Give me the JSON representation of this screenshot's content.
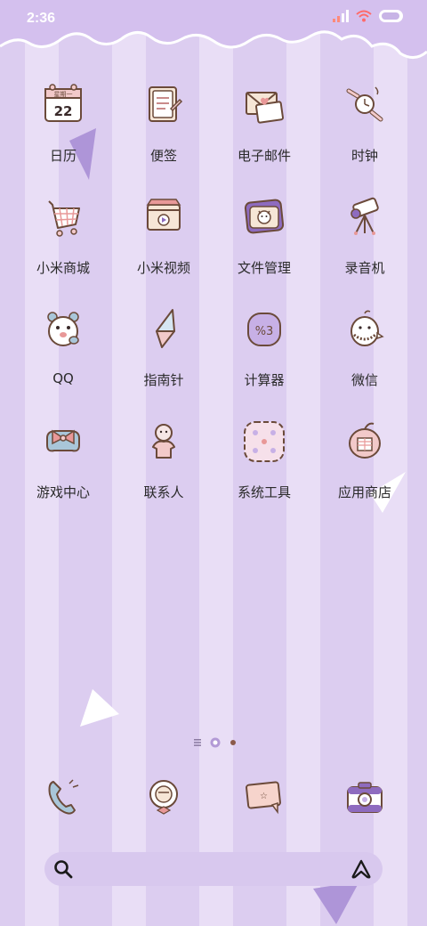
{
  "status_bar": {
    "time": "2:36"
  },
  "apps": [
    {
      "label": "日历",
      "icon": "calendar-icon",
      "calendar_text_top": "星期一",
      "calendar_date": "22"
    },
    {
      "label": "便签",
      "icon": "notes-icon"
    },
    {
      "label": "电子邮件",
      "icon": "email-icon"
    },
    {
      "label": "时钟",
      "icon": "clock-icon"
    },
    {
      "label": "小米商城",
      "icon": "shopping-cart-icon"
    },
    {
      "label": "小米视频",
      "icon": "video-icon"
    },
    {
      "label": "文件管理",
      "icon": "file-manager-icon"
    },
    {
      "label": "录音机",
      "icon": "recorder-icon"
    },
    {
      "label": "QQ",
      "icon": "qq-icon"
    },
    {
      "label": "指南针",
      "icon": "compass-icon"
    },
    {
      "label": "计算器",
      "icon": "calculator-icon",
      "calc_text": "%3"
    },
    {
      "label": "微信",
      "icon": "wechat-icon"
    },
    {
      "label": "游戏中心",
      "icon": "game-center-icon"
    },
    {
      "label": "联系人",
      "icon": "contacts-icon"
    },
    {
      "label": "系统工具",
      "icon": "system-tools-icon"
    },
    {
      "label": "应用商店",
      "icon": "app-store-icon"
    }
  ],
  "page_indicator": {
    "pages": 3,
    "active": 3
  },
  "dock": [
    {
      "icon": "phone-icon"
    },
    {
      "icon": "browser-icon"
    },
    {
      "icon": "messages-icon"
    },
    {
      "icon": "camera-icon"
    }
  ],
  "colors": {
    "stripe_dark": "#dccdf0",
    "stripe_light": "#e9def6",
    "banner": "#d4c0ee",
    "label": "#2a2a2a",
    "icon_outline": "#6b4a3a",
    "icon_pink": "#f2c9c9",
    "icon_purple": "#8e6bbf"
  }
}
